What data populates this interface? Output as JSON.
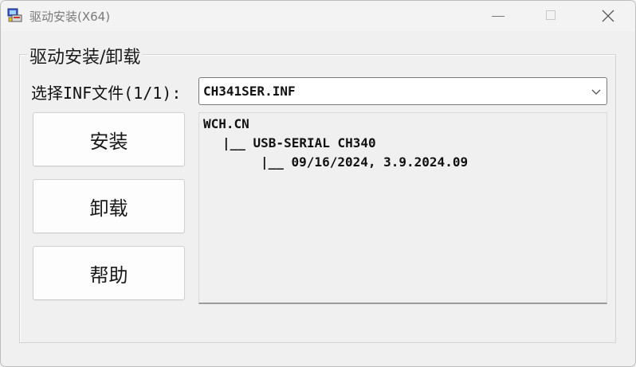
{
  "window": {
    "title": "驱动安装(X64)",
    "icon": "driver-setup-icon"
  },
  "group": {
    "title": "驱动安装/卸载"
  },
  "inf_select": {
    "label": "选择INF文件(1/1):",
    "value": "CH341SER.INF"
  },
  "buttons": {
    "install": "安装",
    "uninstall": "卸载",
    "help": "帮助"
  },
  "tree": {
    "lines": [
      "WCH.CN",
      "|__ USB-SERIAL CH340",
      "|__ 09/16/2024, 3.9.2024.09"
    ]
  }
}
